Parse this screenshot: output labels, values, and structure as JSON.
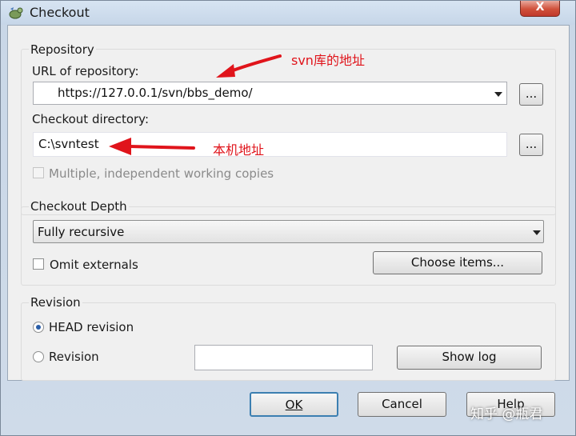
{
  "window": {
    "title": "Checkout",
    "close_label": "X"
  },
  "repository": {
    "group_label": "Repository",
    "url_label": "URL of repository:",
    "url_value": "https://127.0.0.1/svn/bbs_demo/",
    "browse_label": "...",
    "dir_label": "Checkout directory:",
    "dir_value": "C:\\svntest",
    "dir_browse_label": "...",
    "multiple_label": "Multiple, independent working copies",
    "multiple_checked": false
  },
  "depth": {
    "group_label": "Checkout Depth",
    "selected": "Fully recursive",
    "omit_label": "Omit externals",
    "omit_checked": false,
    "choose_items_label": "Choose items..."
  },
  "revision": {
    "group_label": "Revision",
    "head_label": "HEAD revision",
    "head_selected": true,
    "revision_label": "Revision",
    "revision_value": "",
    "show_log_label": "Show log"
  },
  "buttons": {
    "ok": "OK",
    "cancel": "Cancel",
    "help": "Help"
  },
  "annotations": {
    "svn_addr": "svn库的地址",
    "local_addr": "本机地址",
    "color": "#e0141b"
  },
  "watermark": "知乎 @瓶君"
}
